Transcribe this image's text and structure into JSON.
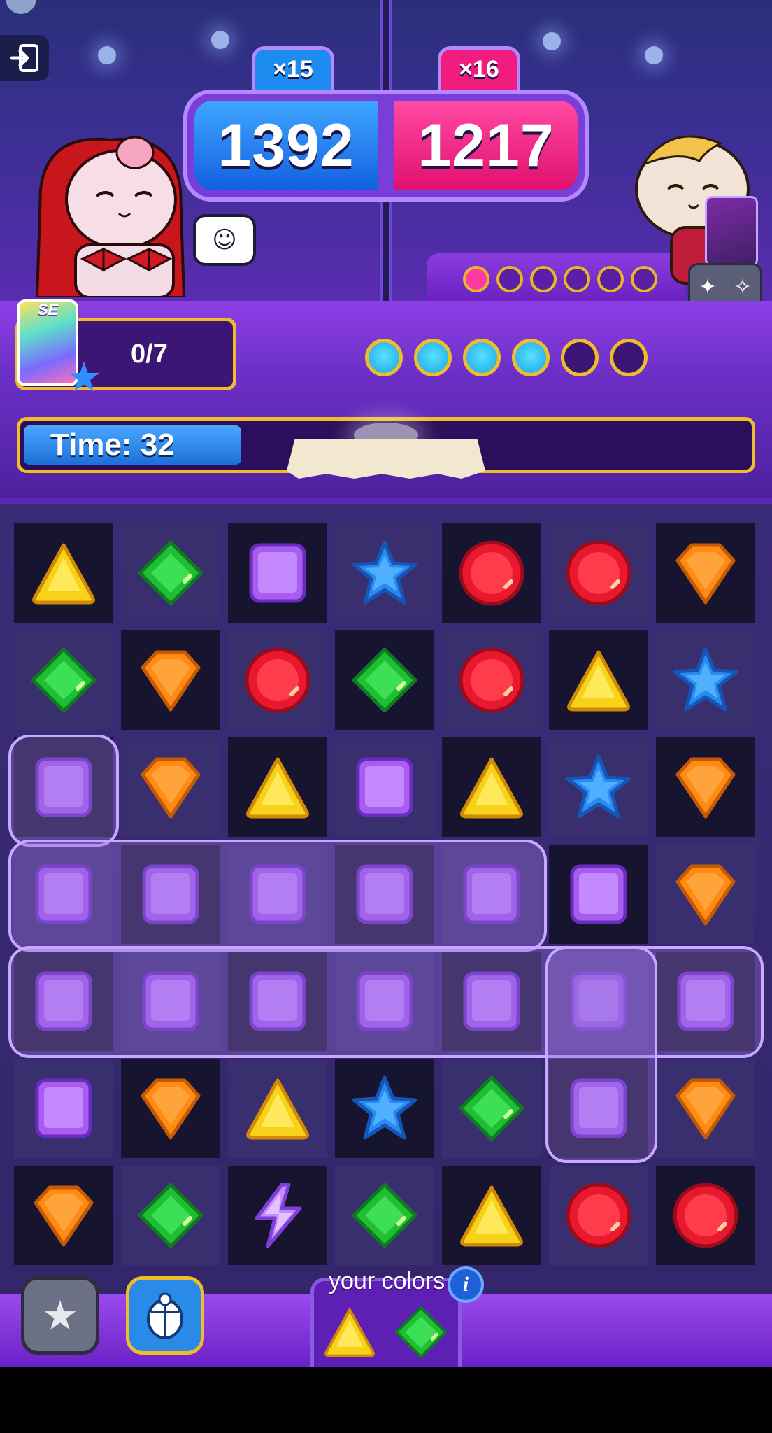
{
  "player": {
    "score": "1392",
    "multiplier": "×15",
    "progress": "0/7",
    "rounds_won": 4,
    "rounds_total": 6
  },
  "opponent": {
    "score": "1217",
    "multiplier": "×16",
    "rounds_won": 1,
    "rounds_total": 6
  },
  "hero_card": {
    "badge": "SE"
  },
  "timer": {
    "label": "Time: 32",
    "remaining_fraction": 0.3
  },
  "board": {
    "rows": [
      [
        "yellow-triangle",
        "green-diamond",
        "purple-square",
        "blue-star",
        "red-circle",
        "red-circle",
        "orange-gem"
      ],
      [
        "green-diamond",
        "orange-gem",
        "red-circle",
        "green-diamond",
        "red-circle",
        "yellow-triangle",
        "blue-star"
      ],
      [
        "purple-square",
        "orange-gem",
        "yellow-triangle",
        "purple-square",
        "yellow-triangle",
        "blue-star",
        "orange-gem"
      ],
      [
        "purple-square",
        "purple-square",
        "purple-square",
        "purple-square",
        "purple-square",
        "purple-square",
        "orange-gem"
      ],
      [
        "purple-square",
        "purple-square",
        "purple-square",
        "purple-square",
        "purple-square",
        "purple-square",
        "purple-square"
      ],
      [
        "purple-square",
        "orange-gem",
        "yellow-triangle",
        "blue-star",
        "green-diamond",
        "purple-square",
        "orange-gem"
      ],
      [
        "orange-gem",
        "green-diamond",
        "purple-lightning",
        "green-diamond",
        "yellow-triangle",
        "red-circle",
        "red-circle"
      ]
    ]
  },
  "your_colors": {
    "label": "your colors",
    "info": "i",
    "colors": [
      "yellow-triangle",
      "green-diamond"
    ]
  },
  "colors": {
    "blue": "#1c7cf0",
    "pink": "#f01d7f",
    "gold": "#f0bd2a",
    "purple": "#7a3ed8"
  }
}
